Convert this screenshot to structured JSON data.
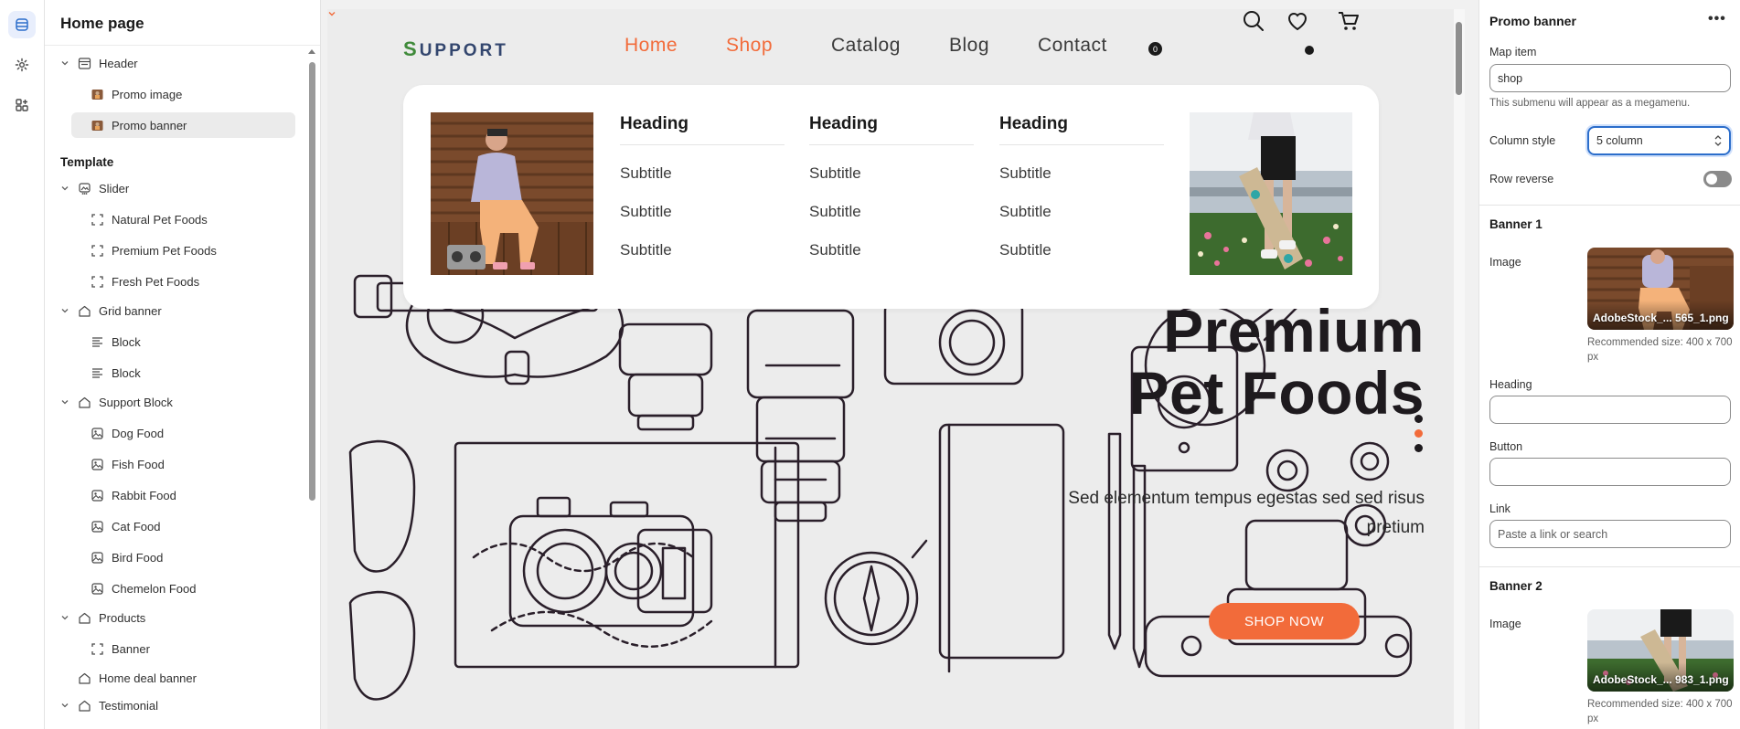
{
  "sidebar": {
    "title": "Home page",
    "template_label": "Template",
    "items": [
      {
        "label": "Header"
      },
      {
        "label": "Promo image"
      },
      {
        "label": "Promo banner"
      },
      {
        "label": "Slider"
      },
      {
        "label": "Natural Pet Foods"
      },
      {
        "label": "Premium Pet Foods"
      },
      {
        "label": "Fresh Pet Foods"
      },
      {
        "label": "Grid banner"
      },
      {
        "label": "Block"
      },
      {
        "label": "Block"
      },
      {
        "label": "Support Block"
      },
      {
        "label": "Dog Food"
      },
      {
        "label": "Fish Food"
      },
      {
        "label": "Rabbit Food"
      },
      {
        "label": "Cat Food"
      },
      {
        "label": "Bird Food"
      },
      {
        "label": "Chemelon Food"
      },
      {
        "label": "Products"
      },
      {
        "label": "Banner"
      },
      {
        "label": "Home deal banner"
      },
      {
        "label": "Testimonial"
      }
    ]
  },
  "preview": {
    "brand_initial": "S",
    "brand_rest": "UPPORT",
    "nav": {
      "home": "Home",
      "shop": "Shop",
      "catalog": "Catalog",
      "blog": "Blog",
      "contact": "Contact"
    },
    "cart_count": "0",
    "mega": {
      "columns": [
        {
          "heading": "Heading",
          "subtitles": [
            "Subtitle",
            "Subtitle",
            "Subtitle"
          ]
        },
        {
          "heading": "Heading",
          "subtitles": [
            "Subtitle",
            "Subtitle",
            "Subtitle"
          ]
        },
        {
          "heading": "Heading",
          "subtitles": [
            "Subtitle",
            "Subtitle",
            "Subtitle"
          ]
        }
      ]
    },
    "hero": {
      "title_line1": "Premium",
      "title_line2": "Pet Foods",
      "text": "Sed elementum tempus egestas sed sed risus pretium",
      "button": "SHOP NOW"
    }
  },
  "panel": {
    "title": "Promo banner",
    "more": "•••",
    "map_item_label": "Map item",
    "map_item_value": "shop",
    "map_item_help": "This submenu will appear as a megamenu.",
    "column_style_label": "Column style",
    "column_style_value": "5 column",
    "row_reverse_label": "Row reverse",
    "banner1": {
      "title": "Banner 1",
      "image_label": "Image",
      "image_name": "AdobeStock_... 565_1.png",
      "recommended": "Recommended size: 400 x 700 px",
      "heading_label": "Heading",
      "heading_value": "",
      "button_label": "Button",
      "button_value": "",
      "link_label": "Link",
      "link_placeholder": "Paste a link or search"
    },
    "banner2": {
      "title": "Banner 2",
      "image_label": "Image",
      "image_name": "AdobeStock_... 983_1.png",
      "recommended": "Recommended size: 400 x 700 px"
    }
  },
  "colors": {
    "accent": "#f26b3a",
    "focus": "#2c6ecb",
    "brand": "#33466e"
  }
}
